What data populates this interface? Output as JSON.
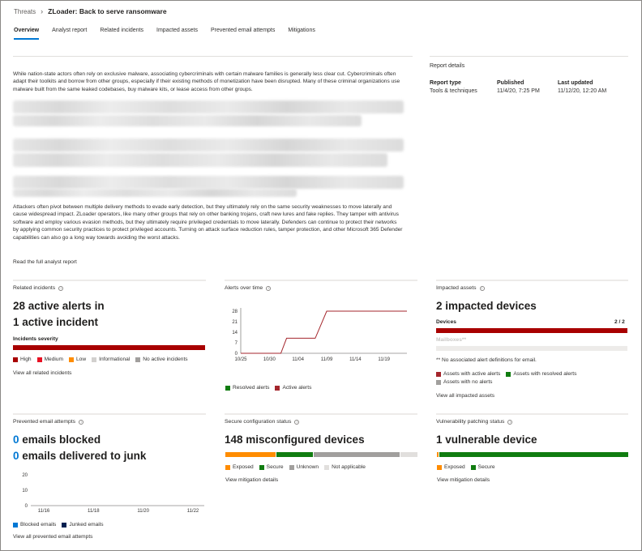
{
  "breadcrumb": {
    "root": "Threats",
    "current": "ZLoader: Back to serve ransomware"
  },
  "tabs": [
    {
      "label": "Overview",
      "active": true
    },
    {
      "label": "Analyst report"
    },
    {
      "label": "Related incidents"
    },
    {
      "label": "Impacted assets"
    },
    {
      "label": "Prevented email attempts"
    },
    {
      "label": "Mitigations"
    }
  ],
  "overview": {
    "para1": "While nation-state actors often rely on exclusive malware, associating cybercriminals with certain malware families is generally less clear cut. Cybercriminals often adapt their toolkits and borrow from other groups, especially if their existing methods of monetization have been disrupted. Many of these criminal organizations use malware built from the same leaked codebases, buy malware kits, or lease access from other groups.",
    "para2": "Attackers often pivot between multiple delivery methods to evade early detection, but they ultimately rely on the same security weaknesses to move laterally and cause widespread impact. ZLoader operators, like many other groups that rely on other banking trojans, craft new lures and fake replies. They tamper with antivirus software and employ various evasion methods, but they ultimately require privileged credentials to move laterally. Defenders can continue to protect their networks by applying common security practices to protect privileged accounts. Turning on attack surface reduction rules, tamper protection, and other Microsoft 365 Defender capabilities can also go a long way towards avoiding the worst attacks.",
    "read_link": "Read the full analyst report"
  },
  "report_details": {
    "title": "Report details",
    "type_label": "Report type",
    "type_value": "Tools & techniques",
    "published_label": "Published",
    "published_value": "11/4/20, 7:25 PM",
    "updated_label": "Last updated",
    "updated_value": "11/12/20, 12:20 AM"
  },
  "related_incidents": {
    "title": "Related incidents",
    "line1": "28 active alerts in",
    "line2": "1 active incident",
    "severity_label": "Incidents severity",
    "legend": [
      "High",
      "Medium",
      "Low",
      "Informational",
      "No active incidents"
    ],
    "link": "View all related incidents"
  },
  "alerts_over_time": {
    "title": "Alerts over time",
    "legend": [
      "Resolved alerts",
      "Active alerts"
    ]
  },
  "impacted_assets": {
    "title": "Impacted assets",
    "headline": "2 impacted devices",
    "devices_label": "Devices",
    "devices_value": "2 / 2",
    "mailboxes_label": "Mailboxes**",
    "note": "** No associated alert definitions for email.",
    "legend": [
      "Assets with active alerts",
      "Assets with resolved alerts",
      "Assets with no alerts"
    ],
    "link": "View all impacted assets"
  },
  "prevented_email": {
    "title": "Prevented email attempts",
    "blocked_num": "0",
    "blocked_text": " emails blocked",
    "junk_num": "0",
    "junk_text": " emails delivered to junk",
    "legend": [
      "Blocked emails",
      "Junked emails"
    ],
    "link": "View all prevented email attempts"
  },
  "secure_config": {
    "title": "Secure configuration status",
    "headline": "148 misconfigured devices",
    "legend": [
      "Exposed",
      "Secure",
      "Unknown",
      "Not applicable"
    ],
    "link": "View mitigation details"
  },
  "vuln_patching": {
    "title": "Vulnerability patching status",
    "headline": "1 vulnerable device",
    "legend": [
      "Exposed",
      "Secure"
    ],
    "link": "View mitigation details"
  },
  "colors": {
    "high": "#a80000",
    "medium": "#e81123",
    "low": "#ff8c00",
    "informational": "#d2d0ce",
    "none": "#a19f9d",
    "resolved": "#107c10",
    "active": "#a4262c",
    "accent": "#0078d4",
    "exposed": "#ff8c00",
    "secure": "#107c10",
    "unknown": "#a19f9d",
    "na": "#e1dfdd",
    "blocked": "#0078d4",
    "junked": "#002050"
  },
  "chart_data": [
    {
      "type": "line",
      "title": "Alerts over time",
      "x_ticks": [
        "10/25",
        "10/30",
        "11/04",
        "11/09",
        "11/14",
        "11/19"
      ],
      "y_ticks": [
        0,
        7,
        14,
        21,
        28
      ],
      "ylim": [
        0,
        28
      ],
      "series": [
        {
          "name": "Resolved alerts",
          "points": []
        },
        {
          "name": "Active alerts",
          "points": [
            {
              "x": "10/25",
              "y": 0
            },
            {
              "x": "11/01",
              "y": 0
            },
            {
              "x": "11/02",
              "y": 10
            },
            {
              "x": "11/07",
              "y": 10
            },
            {
              "x": "11/09",
              "y": 28
            },
            {
              "x": "11/23",
              "y": 28
            }
          ]
        }
      ]
    },
    {
      "type": "bar",
      "title": "Prevented email attempts",
      "x_ticks": [
        "11/16",
        "11/18",
        "11/20",
        "11/22"
      ],
      "y_ticks": [
        0,
        10,
        20
      ],
      "ylim": [
        0,
        20
      ],
      "series": [
        {
          "name": "Blocked emails",
          "values": [
            0,
            0,
            0,
            0
          ]
        },
        {
          "name": "Junked emails",
          "values": [
            0,
            0,
            0,
            0
          ]
        }
      ]
    }
  ]
}
